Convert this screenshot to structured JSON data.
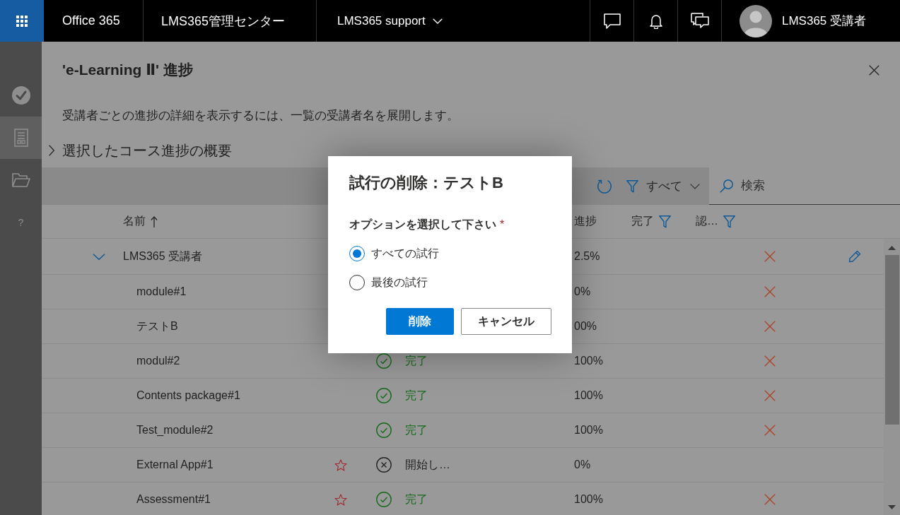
{
  "top_bar": {
    "app_name": "Office 365",
    "site_title": "LMS365管理センター",
    "site_selector": {
      "label": "LMS365 support"
    },
    "user_name": "LMS365 受講者"
  },
  "sidebar": {
    "items": [
      {
        "selected": false
      },
      {
        "selected": true
      },
      {
        "selected": false
      },
      {
        "label": "?",
        "selected": false
      }
    ]
  },
  "panel": {
    "title": "'e-Learning Ⅱ' 進捗",
    "description": "受講者ごとの進捗の詳細を表示するには、一覧の受講者名を展開します。",
    "summary": {
      "label": "選択したコース進捗の概要",
      "expanded": false
    },
    "command_bar": {
      "filter": {
        "label": "すべて"
      },
      "search": {
        "placeholder": "検索"
      }
    },
    "table": {
      "columns": [
        {
          "label": "名前",
          "sort_ascending": true
        },
        {
          "label": "進捗"
        },
        {
          "label": "完了",
          "filter": true
        },
        {
          "label": "認…",
          "filter": true
        }
      ],
      "rows": [
        {
          "name": "LMS365 受講者",
          "expanded": true,
          "starred": false,
          "progress": "2.5%",
          "crossed": true,
          "children": [
            {
              "name": "module#1",
              "starred": false,
              "progress": "0%",
              "crossed": true
            },
            {
              "name": "テストB",
              "starred": false,
              "progress": "00%",
              "crossed": true
            },
            {
              "name": "modul#2",
              "starred": false,
              "status": {
                "kind": "complete",
                "label": "完了"
              },
              "progress": "100%",
              "crossed": true
            },
            {
              "name": "Contents package#1",
              "starred": false,
              "status": {
                "kind": "complete",
                "label": "完了"
              },
              "progress": "100%",
              "crossed": true
            },
            {
              "name": "Test_module#2",
              "starred": false,
              "status": {
                "kind": "complete",
                "label": "完了"
              },
              "progress": "100%",
              "crossed": true
            },
            {
              "name": "External App#1",
              "starred": true,
              "status": {
                "kind": "not_started",
                "label": "開始し…"
              },
              "progress": "0%",
              "crossed": false
            },
            {
              "name": "Assessment#1",
              "starred": true,
              "status": {
                "kind": "complete",
                "label": "完了"
              },
              "progress": "100%",
              "crossed": true
            }
          ]
        }
      ]
    }
  },
  "dialog": {
    "title": "試行の削除：テストB",
    "field_label": "オプションを選択して下さい",
    "required_mark": "*",
    "options": [
      {
        "label": "すべての試行",
        "selected": true
      },
      {
        "label": "最後の試行",
        "selected": false
      }
    ],
    "buttons": [
      {
        "label": "削除",
        "kind": "primary"
      },
      {
        "label": "キャンセル",
        "kind": "secondary"
      }
    ]
  }
}
